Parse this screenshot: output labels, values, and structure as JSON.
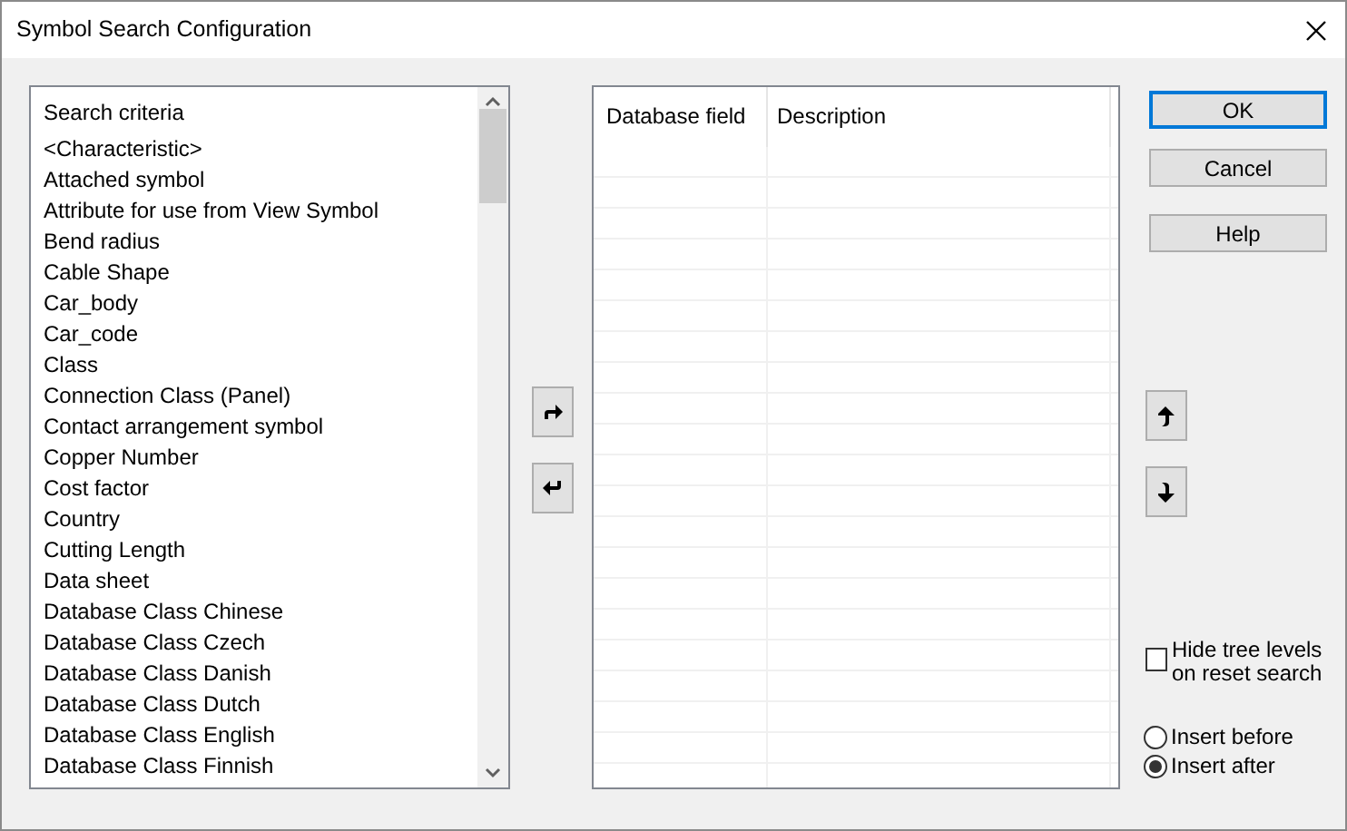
{
  "window": {
    "title": "Symbol Search Configuration"
  },
  "search_criteria": {
    "header": "Search criteria",
    "items": [
      "<Characteristic>",
      "Attached symbol",
      "Attribute for use from View Symbol",
      "Bend radius",
      "Cable Shape",
      "Car_body",
      "Car_code",
      "Class",
      "Connection Class (Panel)",
      "Contact arrangement symbol",
      "Copper Number",
      "Cost factor",
      "Country",
      "Cutting Length",
      "Data sheet",
      "Database Class Chinese",
      "Database Class Czech",
      "Database Class Danish",
      "Database Class Dutch",
      "Database Class English",
      "Database Class Finnish"
    ]
  },
  "table": {
    "columns": [
      "Database field",
      "Description"
    ]
  },
  "buttons": [
    "OK",
    "Cancel",
    "Help"
  ],
  "hide_tree_levels": {
    "label": "Hide tree levels on reset search",
    "checked": false
  },
  "insert_position": [
    {
      "label": "Insert before",
      "selected": false
    },
    {
      "label": "Insert after",
      "selected": true
    }
  ]
}
